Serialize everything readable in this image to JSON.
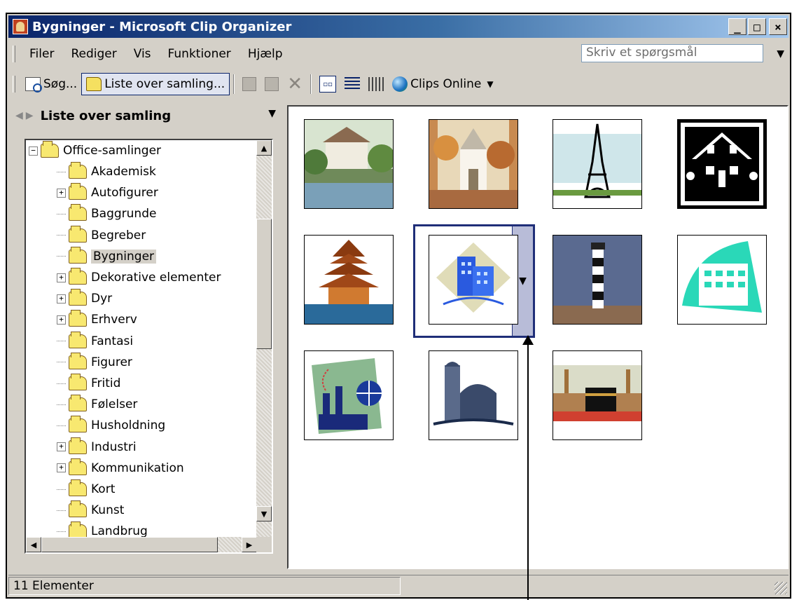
{
  "window": {
    "title": "Bygninger - Microsoft Clip Organizer",
    "min_label": "_",
    "max_label": "□",
    "close_label": "×"
  },
  "menu": {
    "items": [
      "Filer",
      "Rediger",
      "Vis",
      "Funktioner",
      "Hjælp"
    ],
    "ask_placeholder": "Skriv et spørgsmål"
  },
  "toolbar": {
    "search_label": "Søg...",
    "collection_list_label": "Liste over samling...",
    "clips_online_label": "Clips Online"
  },
  "left_pane": {
    "title": "Liste over samling",
    "root": "Office-samlinger",
    "items": [
      {
        "label": "Akademisk",
        "expandable": false
      },
      {
        "label": "Autofigurer",
        "expandable": true
      },
      {
        "label": "Baggrunde",
        "expandable": false
      },
      {
        "label": "Begreber",
        "expandable": false
      },
      {
        "label": "Bygninger",
        "expandable": false,
        "selected": true
      },
      {
        "label": "Dekorative elementer",
        "expandable": true
      },
      {
        "label": "Dyr",
        "expandable": true
      },
      {
        "label": "Erhverv",
        "expandable": true
      },
      {
        "label": "Fantasi",
        "expandable": false
      },
      {
        "label": "Figurer",
        "expandable": false
      },
      {
        "label": "Fritid",
        "expandable": false
      },
      {
        "label": "Følelser",
        "expandable": false
      },
      {
        "label": "Husholdning",
        "expandable": false
      },
      {
        "label": "Industri",
        "expandable": true
      },
      {
        "label": "Kommunikation",
        "expandable": true
      },
      {
        "label": "Kort",
        "expandable": false
      },
      {
        "label": "Kunst",
        "expandable": false
      },
      {
        "label": "Landbrug",
        "expandable": false
      }
    ]
  },
  "clips": [
    {
      "name": "house-by-lake-clip",
      "icon": "landscape"
    },
    {
      "name": "church-autumn-clip",
      "icon": "church"
    },
    {
      "name": "eiffel-tower-clip",
      "icon": "tower"
    },
    {
      "name": "black-house-icon-clip",
      "icon": "house"
    },
    {
      "name": "pagoda-clip",
      "icon": "pagoda"
    },
    {
      "name": "office-building-clip",
      "icon": "office",
      "selected": true
    },
    {
      "name": "lighthouse-clip",
      "icon": "lighthouse"
    },
    {
      "name": "teal-building-clip",
      "icon": "building"
    },
    {
      "name": "factory-globe-clip",
      "icon": "factory"
    },
    {
      "name": "farm-silo-barn-clip",
      "icon": "barn"
    },
    {
      "name": "mosque-kaaba-clip",
      "icon": "mosque"
    }
  ],
  "status": {
    "count_text": "11 Elementer"
  },
  "colors": {
    "titlebar_start": "#0a246a",
    "titlebar_end": "#a6caf0",
    "selection_frame": "#1f2e78",
    "chrome": "#d4d0c8"
  }
}
